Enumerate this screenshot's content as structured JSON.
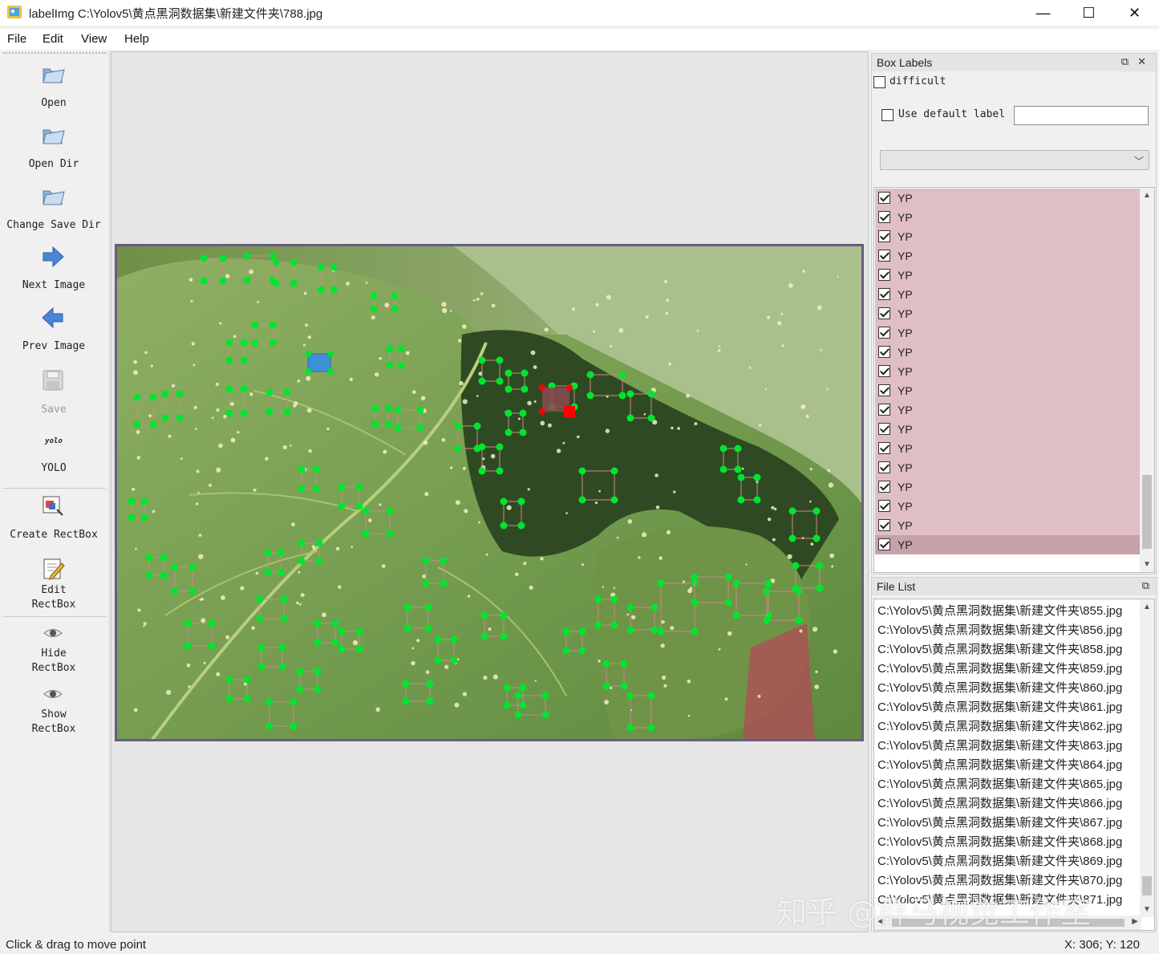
{
  "window": {
    "title": "labelImg C:\\Yolov5\\黄点黑洞数据集\\新建文件夹\\788.jpg",
    "minimize_label": "—",
    "maximize_label": "☐",
    "close_label": "✕"
  },
  "menu": [
    "File",
    "Edit",
    "View",
    "Help"
  ],
  "toolbar": {
    "open": "Open",
    "open_dir": "Open Dir",
    "change_save_dir": "Change Save Dir",
    "next_image": "Next Image",
    "prev_image": "Prev Image",
    "save": "Save",
    "format_icon_text": "yolo",
    "format": "YOLO",
    "create_rectbox": "Create RectBox",
    "edit_rectbox_1": "Edit",
    "edit_rectbox_2": "RectBox",
    "hide_rectbox_1": "Hide",
    "hide_rectbox_2": "RectBox",
    "show_rectbox_1": "Show",
    "show_rectbox_2": "RectBox"
  },
  "box_labels": {
    "title": "Box Labels",
    "float_icon": "float-icon",
    "close_icon": "close-icon",
    "difficult_label": "difficult",
    "difficult_checked": false,
    "use_default_label": "Use default label",
    "use_default_checked": false,
    "default_label_value": "",
    "combo_value": "",
    "labels": [
      "YP",
      "YP",
      "YP",
      "YP",
      "YP",
      "YP",
      "YP",
      "YP",
      "YP",
      "YP",
      "YP",
      "YP",
      "YP",
      "YP",
      "YP",
      "YP",
      "YP",
      "YP",
      "YP"
    ],
    "selected_index": 18,
    "row_color": "#dfbec4",
    "selected_row_color": "#c6a2a9"
  },
  "file_list": {
    "title": "File List",
    "files": [
      "C:\\Yolov5\\黄点黑洞数据集\\新建文件夹\\855.jpg",
      "C:\\Yolov5\\黄点黑洞数据集\\新建文件夹\\856.jpg",
      "C:\\Yolov5\\黄点黑洞数据集\\新建文件夹\\858.jpg",
      "C:\\Yolov5\\黄点黑洞数据集\\新建文件夹\\859.jpg",
      "C:\\Yolov5\\黄点黑洞数据集\\新建文件夹\\860.jpg",
      "C:\\Yolov5\\黄点黑洞数据集\\新建文件夹\\861.jpg",
      "C:\\Yolov5\\黄点黑洞数据集\\新建文件夹\\862.jpg",
      "C:\\Yolov5\\黄点黑洞数据集\\新建文件夹\\863.jpg",
      "C:\\Yolov5\\黄点黑洞数据集\\新建文件夹\\864.jpg",
      "C:\\Yolov5\\黄点黑洞数据集\\新建文件夹\\865.jpg",
      "C:\\Yolov5\\黄点黑洞数据集\\新建文件夹\\866.jpg",
      "C:\\Yolov5\\黄点黑洞数据集\\新建文件夹\\867.jpg",
      "C:\\Yolov5\\黄点黑洞数据集\\新建文件夹\\868.jpg",
      "C:\\Yolov5\\黄点黑洞数据集\\新建文件夹\\869.jpg",
      "C:\\Yolov5\\黄点黑洞数据集\\新建文件夹\\870.jpg",
      "C:\\Yolov5\\黄点黑洞数据集\\新建文件夹\\871.jpg"
    ]
  },
  "status": {
    "message": "Click & drag to move point",
    "coords": "X: 306; Y: 120"
  },
  "watermark": "知乎 @群马视觉工作室",
  "colors": {
    "box_vertex": "#00e62e",
    "selected_box_fill": "#3d8fd6",
    "active_vertex": "#ff0000",
    "image_border": "#6a5c80"
  }
}
